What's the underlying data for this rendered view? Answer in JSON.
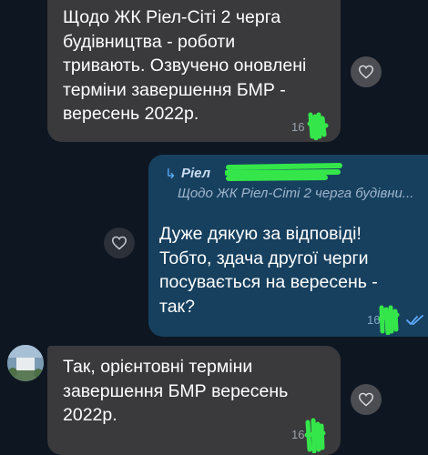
{
  "messages": [
    {
      "lines": [
        "Щодо ЖК Ріел-Сіті 2 черга",
        "будівництва - роботи",
        "тривають. Озвучено оновлені",
        "терміни завершення БМР -",
        "вересень 2022р."
      ],
      "time": "16"
    },
    {
      "reply": {
        "arrow": "↳",
        "name": "Ріел",
        "snippet": "Щодо ЖК Ріел-Сіті 2 черга будівни..."
      },
      "lines": [
        "Дуже дякую за відповіді!",
        "Тобто, здача другої черги",
        "посувається на вересень -",
        "так?"
      ],
      "time": "16"
    },
    {
      "lines": [
        "Так, орієнтовні терміни",
        "завершення БМР вересень",
        "2022р."
      ],
      "time": "16"
    }
  ],
  "icons": {
    "reaction": "heart-outline-icon",
    "read_status": "double-check-icon"
  },
  "colors": {
    "background": "#0e1621",
    "incoming_bubble": "#3a3a3d",
    "outgoing_bubble": "#17405f",
    "redaction_green": "#35e64a"
  }
}
